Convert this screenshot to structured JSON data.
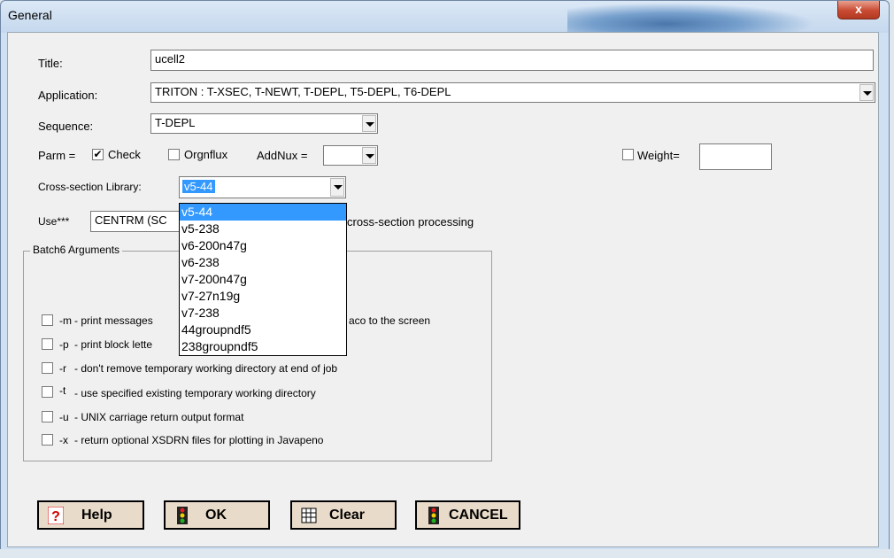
{
  "window": {
    "title": "General",
    "close_label": "x"
  },
  "form": {
    "title_label": "Title:",
    "title_value": "ucell2",
    "application_label": "Application:",
    "application_value": "TRITON : T-XSEC, T-NEWT, T-DEPL, T5-DEPL, T6-DEPL",
    "sequence_label": "Sequence:",
    "sequence_value": "T-DEPL",
    "parm_label": "Parm =",
    "check_label": "Check",
    "check_checked": true,
    "orgnflux_label": "Orgnflux",
    "addnux_label": "AddNux =",
    "addnux_value": "",
    "weight_label": "Weight=",
    "weight_value": "",
    "xslib_label": "Cross-section Library:",
    "xslib_value": "v5-44",
    "use_label": "Use***",
    "use_value": "CENTRM (SC",
    "use_suffix": "cross-section processing"
  },
  "xslib_options": [
    "v5-44",
    "v5-238",
    "v6-200n47g",
    "v6-238",
    "v7-200n47g",
    "v7-27n19g",
    "v7-238",
    "44groupndf5",
    "238groupndf5"
  ],
  "batch": {
    "title": "Batch6 Arguments",
    "args": [
      {
        "flag": "-m",
        "text": "- print messages",
        "tail": "aco to the screen"
      },
      {
        "flag": "-p",
        "text": "- print block lette",
        "tail": ""
      },
      {
        "flag": "-r",
        "text": "- don't remove temporary working directory at end of job",
        "tail": ""
      },
      {
        "flag": "-t",
        "text": "- use specified existing temporary working directory",
        "tail": ""
      },
      {
        "flag": "-u",
        "text": "- UNIX carriage return output format",
        "tail": ""
      },
      {
        "flag": "-x",
        "text": "- return optional XSDRN files for plotting in Javapeno",
        "tail": ""
      }
    ]
  },
  "buttons": {
    "help": "Help",
    "ok": "OK",
    "clear": "Clear",
    "cancel": "CANCEL"
  },
  "colors": {
    "selection": "#3399ff",
    "button_bg": "#e9dbc9",
    "help_icon": "#d00000"
  }
}
